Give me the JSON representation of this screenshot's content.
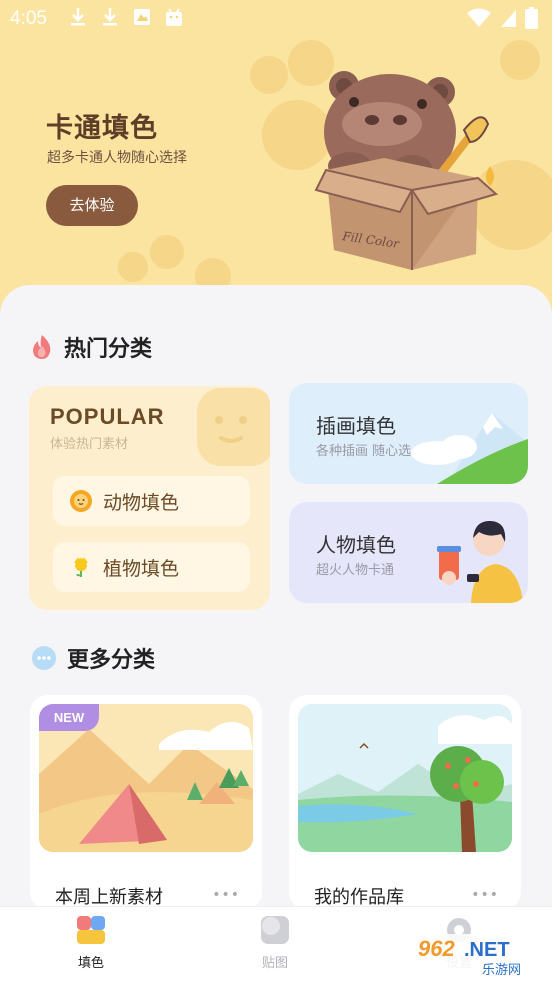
{
  "status_bar": {
    "time": "4:05",
    "left_icons": [
      "download-icon",
      "download-icon",
      "image-icon",
      "android-icon"
    ],
    "right_icons": [
      "wifi-icon",
      "signal-icon",
      "battery-icon"
    ]
  },
  "hero": {
    "title": "卡通填色",
    "subtitle": "超多卡通人物随心选择",
    "button": "去体验",
    "mascot_text": "Fill Color",
    "background_color": "#fbe3a0"
  },
  "hot_section": {
    "title": "热门分类",
    "icon": "fire-icon",
    "popular": {
      "title": "POPULAR",
      "subtitle": "体验热门素材",
      "items": [
        {
          "label": "动物填色",
          "icon": "lion-icon"
        },
        {
          "label": "植物填色",
          "icon": "flower-icon"
        }
      ]
    },
    "cards": [
      {
        "title": "插画填色",
        "subtitle": "各种插画 随心选",
        "color": "#deeefb"
      },
      {
        "title": "人物填色",
        "subtitle": "超火人物卡通",
        "color": "#e6e6fb"
      }
    ]
  },
  "more_section": {
    "title": "更多分类",
    "icon": "more-dots-icon",
    "cards": [
      {
        "label": "本周上新素材",
        "badge": "NEW",
        "dots": "•••"
      },
      {
        "label": "我的作品库",
        "dots": "•••"
      }
    ]
  },
  "tabbar": {
    "tabs": [
      {
        "label": "填色",
        "active": true
      },
      {
        "label": "贴图",
        "active": false
      },
      {
        "label": "设置",
        "active": false
      }
    ]
  },
  "watermark": {
    "brand": "962.NET",
    "sub": "乐游网"
  }
}
